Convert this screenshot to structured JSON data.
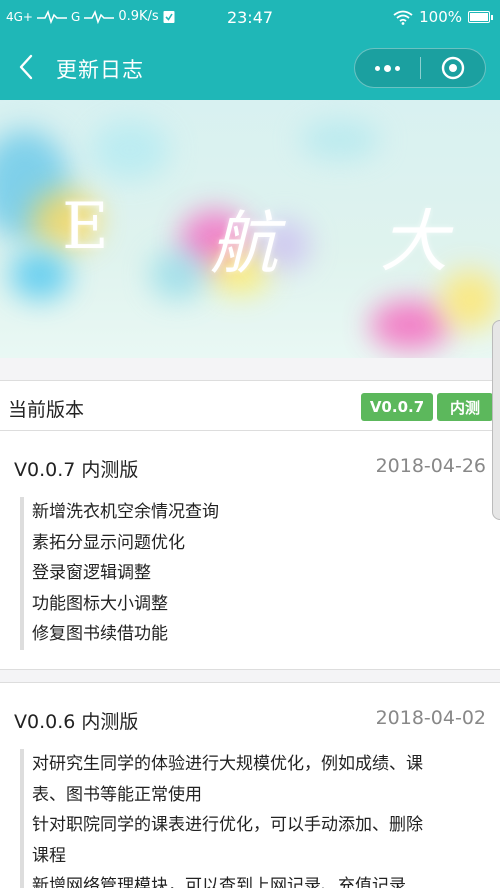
{
  "status_bar": {
    "network": "4G+",
    "network2": "G",
    "speed": "0.9K/s",
    "time": "23:47",
    "battery": "100%",
    "battery_level": 1.0
  },
  "navbar": {
    "title": "更新日志",
    "back_icon": "chevron-left-icon",
    "more_icon": "more-dots-icon",
    "close_icon": "target-circle-icon"
  },
  "banner": {
    "chars": [
      "E",
      "航",
      "大"
    ]
  },
  "current_version": {
    "label": "当前版本",
    "version_tag": "V0.0.7",
    "type_tag": "内测",
    "tag_color": "#5cb85c"
  },
  "changelog": [
    {
      "title": "V0.0.7 内测版",
      "date": "2018-04-26",
      "items": [
        "新增洗衣机空余情况查询",
        "素拓分显示问题优化",
        "登录窗逻辑调整",
        "功能图标大小调整",
        "修复图书续借功能"
      ]
    },
    {
      "title": "V0.0.6 内测版",
      "date": "2018-04-02",
      "items": [
        "对研究生同学的体验进行大规模优化，例如成绩、课",
        "表、图书等能正常使用",
        "针对职院同学的课表进行优化，可以手动添加、删除",
        "课程",
        "新增网络管理模块，可以查到上网记录、充值记录"
      ]
    }
  ],
  "colors": {
    "accent": "#1fb7b7"
  }
}
